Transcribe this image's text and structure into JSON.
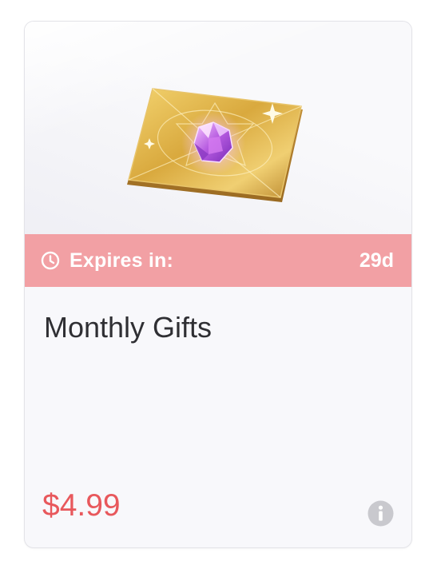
{
  "card": {
    "expiry": {
      "icon": "clock-icon",
      "label": "Expires in:",
      "value": "29d"
    },
    "title": "Monthly Gifts",
    "price": "$4.99",
    "info_icon": "info-icon",
    "image_icon": "gold-card-gem-icon"
  },
  "colors": {
    "expiry_bar": "#f2a0a4",
    "price": "#e8585c",
    "title": "#2f2f33",
    "info_icon": "#c9c9ce"
  }
}
